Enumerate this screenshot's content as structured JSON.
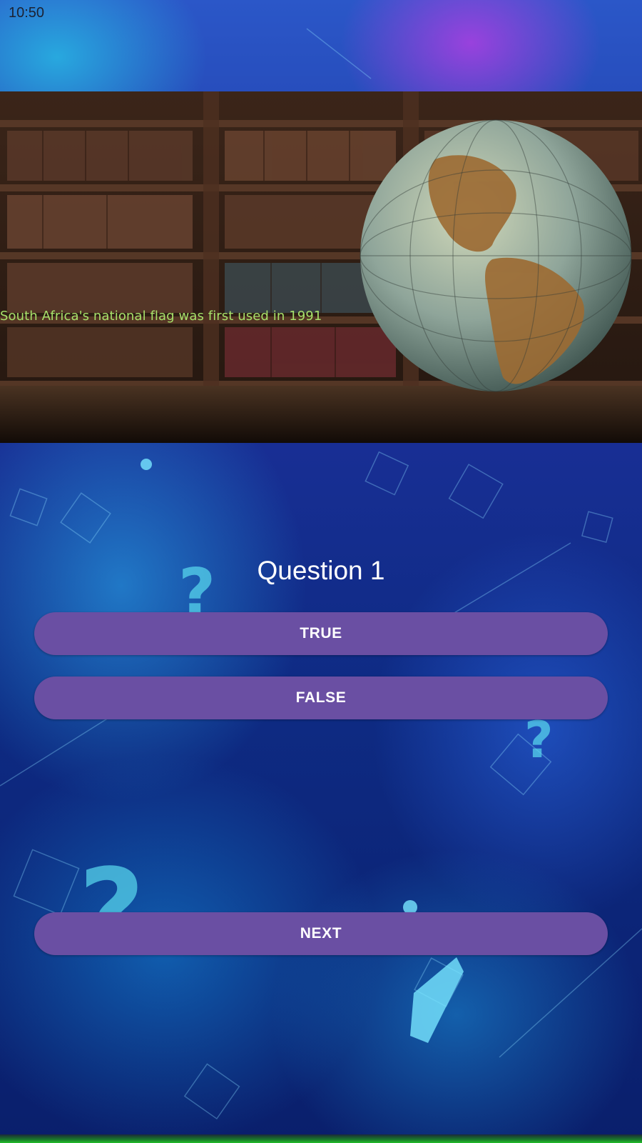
{
  "status_bar": {
    "time": "10:50"
  },
  "hero": {
    "caption": "South Africa's national flag was first used in 1991"
  },
  "question": {
    "title": "Question 1"
  },
  "buttons": {
    "true_label": "TRUE",
    "false_label": "FALSE",
    "next_label": "NEXT"
  },
  "colors": {
    "button": "#6a4fa3",
    "caption": "#a7e06a",
    "bottom_bar": "#22c02a"
  }
}
